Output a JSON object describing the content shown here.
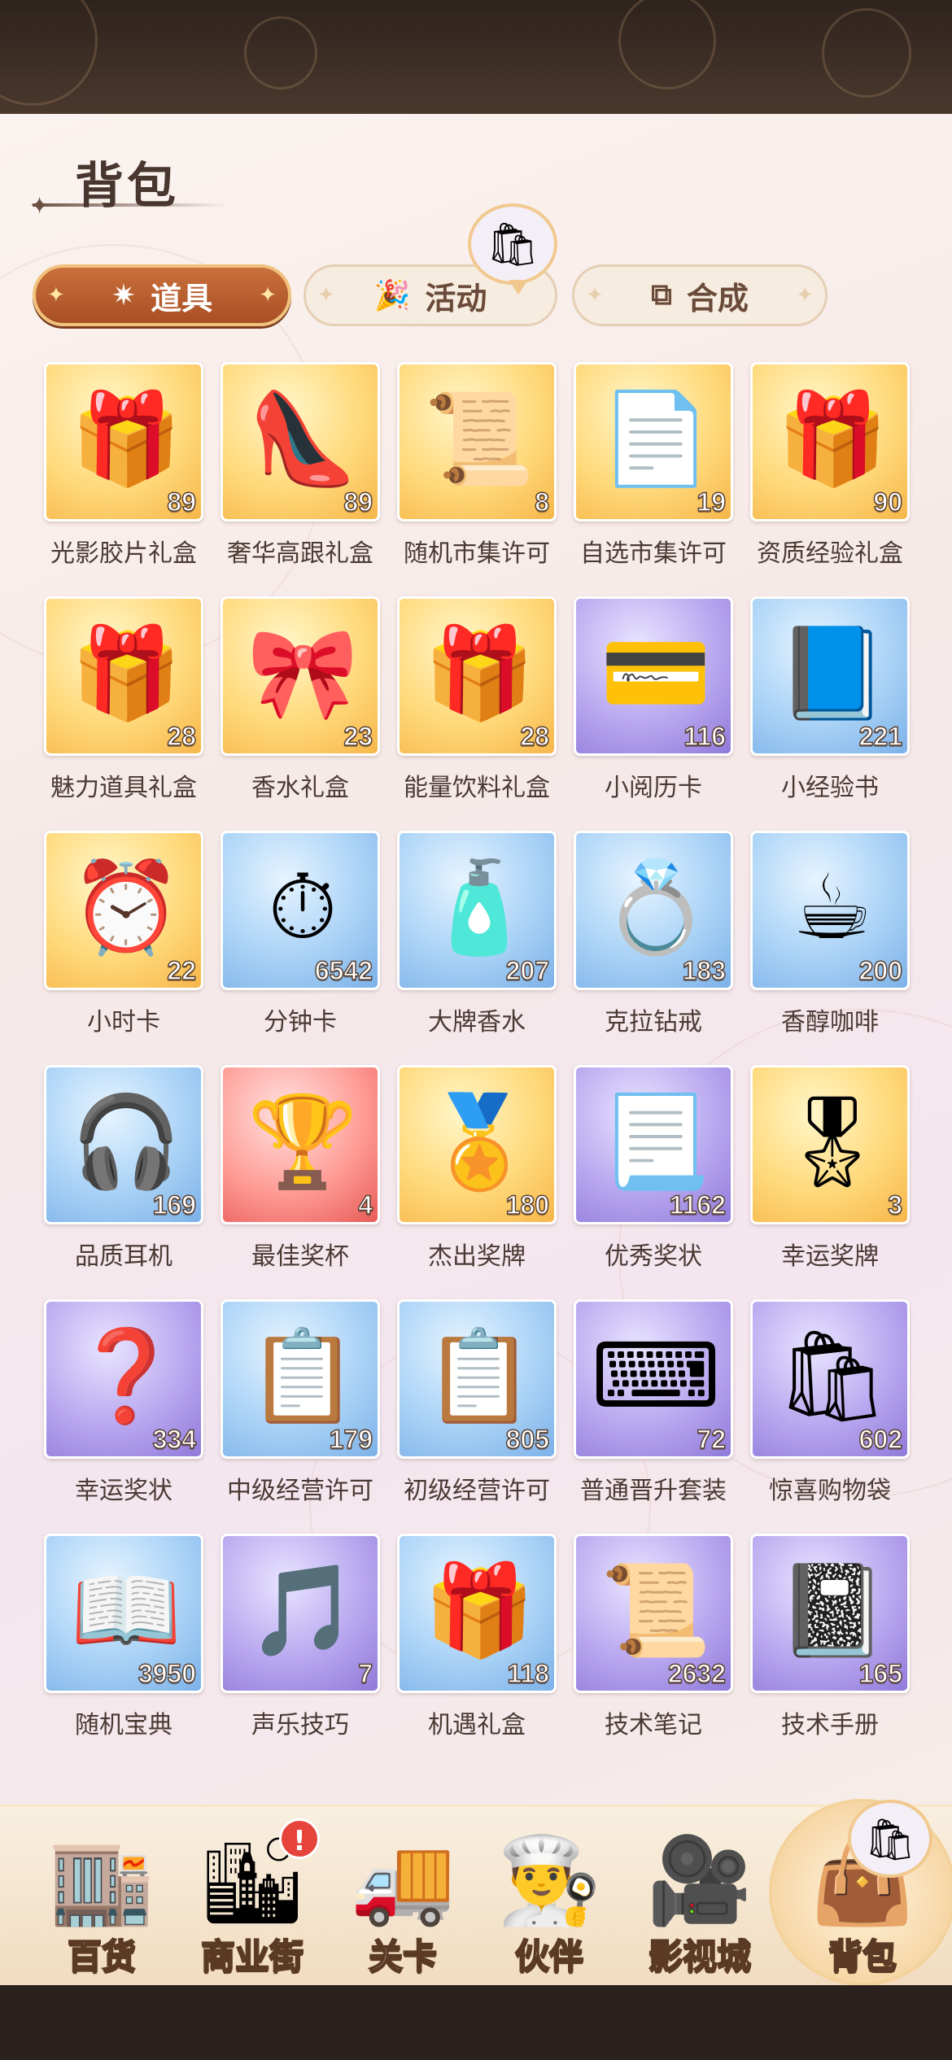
{
  "page": {
    "title": "背包"
  },
  "tabs": [
    {
      "label": "道具",
      "icon": "wand-sparkle-icon",
      "active": true
    },
    {
      "label": "活动",
      "icon": "party-popper-icon",
      "active": false
    },
    {
      "label": "合成",
      "icon": "merge-squares-icon",
      "active": false
    }
  ],
  "items": [
    {
      "name": "光影胶片礼盒",
      "count": "89",
      "bg": "gold",
      "icon": "gift-box-film-icon",
      "glyph": "🎁"
    },
    {
      "name": "奢华高跟礼盒",
      "count": "89",
      "bg": "gold",
      "icon": "gift-box-heels-icon",
      "glyph": "👠"
    },
    {
      "name": "随机市集许可",
      "count": "8",
      "bg": "gold",
      "icon": "market-permit-icon",
      "glyph": "📜"
    },
    {
      "name": "自选市集许可",
      "count": "19",
      "bg": "gold",
      "icon": "selectable-permit-icon",
      "glyph": "📄"
    },
    {
      "name": "资质经验礼盒",
      "count": "90",
      "bg": "gold",
      "icon": "exp-gift-box-icon",
      "glyph": "🎁"
    },
    {
      "name": "魅力道具礼盒",
      "count": "28",
      "bg": "gold",
      "icon": "charm-gift-box-icon",
      "glyph": "🎁"
    },
    {
      "name": "香水礼盒",
      "count": "23",
      "bg": "gold",
      "icon": "perfume-gift-box-icon",
      "glyph": "🎀"
    },
    {
      "name": "能量饮料礼盒",
      "count": "28",
      "bg": "gold",
      "icon": "energy-drink-box-icon",
      "glyph": "🎁"
    },
    {
      "name": "小阅历卡",
      "count": "116",
      "bg": "purple",
      "icon": "experience-card-icon",
      "glyph": "💳"
    },
    {
      "name": "小经验书",
      "count": "221",
      "bg": "blue",
      "icon": "exp-book-icon",
      "glyph": "📘"
    },
    {
      "name": "小时卡",
      "count": "22",
      "bg": "gold",
      "icon": "hour-card-icon",
      "glyph": "⏰"
    },
    {
      "name": "分钟卡",
      "count": "6542",
      "bg": "blue",
      "icon": "minute-card-icon",
      "glyph": "⏱"
    },
    {
      "name": "大牌香水",
      "count": "207",
      "bg": "blue",
      "icon": "perfume-bottle-icon",
      "glyph": "🧴"
    },
    {
      "name": "克拉钻戒",
      "count": "183",
      "bg": "blue",
      "icon": "diamond-ring-icon",
      "glyph": "💍"
    },
    {
      "name": "香醇咖啡",
      "count": "200",
      "bg": "blue",
      "icon": "coffee-cup-icon",
      "glyph": "☕"
    },
    {
      "name": "品质耳机",
      "count": "169",
      "bg": "blue",
      "icon": "headphones-icon",
      "glyph": "🎧"
    },
    {
      "name": "最佳奖杯",
      "count": "4",
      "bg": "red",
      "icon": "trophy-icon",
      "glyph": "🏆"
    },
    {
      "name": "杰出奖牌",
      "count": "180",
      "bg": "gold",
      "icon": "medal-icon",
      "glyph": "🏅"
    },
    {
      "name": "优秀奖状",
      "count": "1162",
      "bg": "purple",
      "icon": "certificate-icon",
      "glyph": "📃"
    },
    {
      "name": "幸运奖牌",
      "count": "3",
      "bg": "gold",
      "icon": "mystery-medal-icon",
      "glyph": "🎖"
    },
    {
      "name": "幸运奖状",
      "count": "334",
      "bg": "purple",
      "icon": "mystery-certificate-icon",
      "glyph": "❓"
    },
    {
      "name": "中级经营许可",
      "count": "179",
      "bg": "blue",
      "icon": "clipboard-permit-icon",
      "glyph": "📋"
    },
    {
      "name": "初级经营许可",
      "count": "805",
      "bg": "blue",
      "icon": "clipboard-basic-icon",
      "glyph": "📋"
    },
    {
      "name": "普通晋升套装",
      "count": "72",
      "bg": "purple",
      "icon": "promotion-kit-icon",
      "glyph": "⌨"
    },
    {
      "name": "惊喜购物袋",
      "count": "602",
      "bg": "purple",
      "icon": "surprise-bag-icon",
      "glyph": "🛍"
    },
    {
      "name": "随机宝典",
      "count": "3950",
      "bg": "blue",
      "icon": "random-book-icon",
      "glyph": "📖"
    },
    {
      "name": "声乐技巧",
      "count": "7",
      "bg": "purple",
      "icon": "music-note-icon",
      "glyph": "🎵"
    },
    {
      "name": "机遇礼盒",
      "count": "118",
      "bg": "blue",
      "icon": "mystery-gift-box-icon",
      "glyph": "🎁"
    },
    {
      "name": "技术笔记",
      "count": "2632",
      "bg": "purple",
      "icon": "tech-notes-icon",
      "glyph": "📜"
    },
    {
      "name": "技术手册",
      "count": "165",
      "bg": "purple",
      "icon": "tech-manual-icon",
      "glyph": "📓"
    }
  ],
  "nav": [
    {
      "label": "百货",
      "icon": "department-store-icon",
      "glyph": "🏬",
      "active": false,
      "badge": ""
    },
    {
      "label": "商业街",
      "icon": "commercial-street-icon",
      "glyph": "🏙",
      "active": false,
      "badge": "!"
    },
    {
      "label": "关卡",
      "icon": "truck-level-icon",
      "glyph": "🚚",
      "active": false,
      "badge": ""
    },
    {
      "label": "伙伴",
      "icon": "partner-chef-icon",
      "glyph": "👨‍🍳",
      "active": false,
      "badge": ""
    },
    {
      "label": "影视城",
      "icon": "film-camera-icon",
      "glyph": "🎥",
      "active": false,
      "badge": ""
    },
    {
      "label": "背包",
      "icon": "handbag-icon",
      "glyph": "👜",
      "active": true,
      "badge": ""
    }
  ]
}
